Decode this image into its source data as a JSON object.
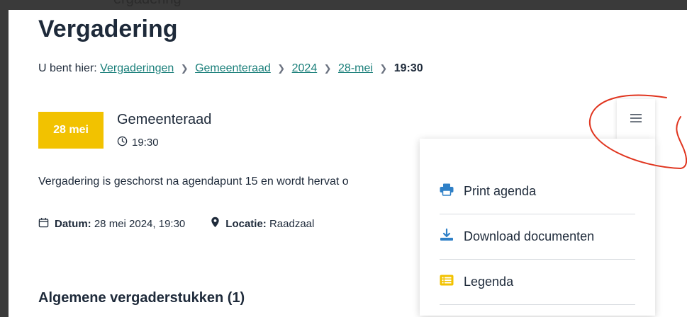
{
  "top_partial_text": "ergadering",
  "page_title": "Vergadering",
  "breadcrumb": {
    "prefix": "U bent hier:",
    "links": [
      "Vergaderingen",
      "Gemeenteraad",
      "2024",
      "28-mei"
    ],
    "current": "19:30"
  },
  "meeting": {
    "badge": "28 mei",
    "title": "Gemeenteraad",
    "time": "19:30"
  },
  "notice": "Vergadering is geschorst na agendapunt 15 en wordt hervat o",
  "details": {
    "date_label": "Datum:",
    "date_value": "28 mei 2024, 19:30",
    "location_label": "Locatie:",
    "location_value": "Raadzaal"
  },
  "section_title": "Algemene vergaderstukken (1)",
  "menu": {
    "items": [
      "Print agenda",
      "Download documenten",
      "Legenda"
    ]
  },
  "colors": {
    "badge": "#f2c200",
    "link": "#1a7f7a",
    "icon_blue": "#2f80c7",
    "icon_yellow": "#f2c200",
    "annotation": "#e0341e"
  }
}
